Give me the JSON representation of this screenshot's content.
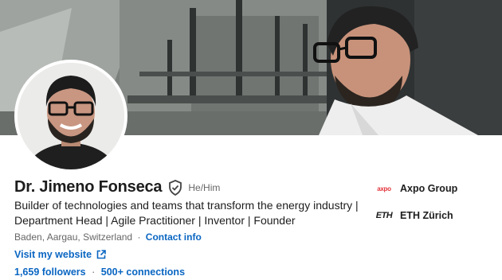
{
  "profile": {
    "name": "Dr. Jimeno Fonseca",
    "pronouns": "He/Him",
    "headline": "Builder of technologies and teams that transform the energy industry | Department Head | Agile Practitioner | Inventor | Founder",
    "location": "Baden, Aargau, Switzerland",
    "separator": "·",
    "contact_info_label": "Contact info",
    "website_label": "Visit my website",
    "followers": "1,659 followers",
    "connections": "500+ connections"
  },
  "organizations": [
    {
      "name": "Axpo Group",
      "logo_text": "axpo",
      "logo_icon": "axpo-logo"
    },
    {
      "name": "ETH Zürich",
      "logo_text": "ETH",
      "logo_icon": "eth-logo"
    }
  ],
  "colors": {
    "link": "#0a66c2",
    "text": "#1d1d1d",
    "muted": "#666666",
    "axpo_red": "#e2333a"
  },
  "icons": {
    "verification": "verified-shield-icon",
    "external_link": "external-link-icon"
  }
}
